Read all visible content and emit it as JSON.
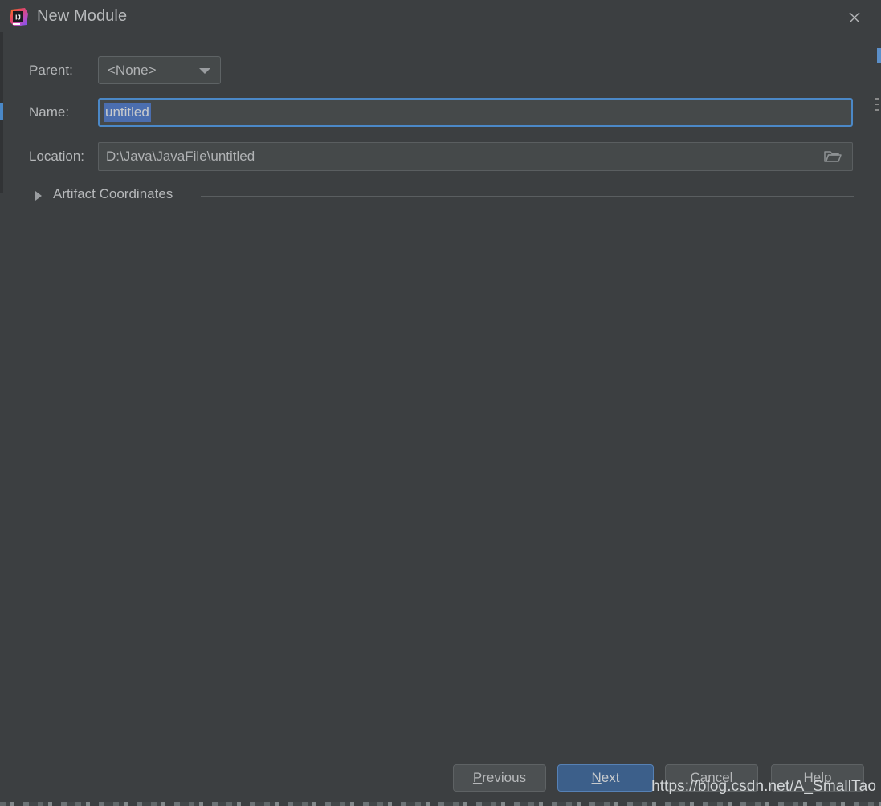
{
  "window": {
    "title": "New Module",
    "icon": "intellij-idea-logo",
    "close_icon": "close-icon"
  },
  "form": {
    "parent": {
      "label": "Parent:",
      "value": "<None>",
      "arrow_icon": "chevron-down-icon"
    },
    "name": {
      "label": "Name:",
      "value": "untitled",
      "selected": true
    },
    "location": {
      "label": "Location:",
      "value": "D:\\Java\\JavaFile\\untitled",
      "browse_icon": "folder-icon"
    }
  },
  "section": {
    "label": "Artifact Coordinates",
    "expanded": false,
    "arrow_icon": "triangle-right-icon"
  },
  "footer": {
    "previous": {
      "mnemonic": "P",
      "rest": "revious"
    },
    "next": {
      "mnemonic": "N",
      "rest": "ext"
    },
    "cancel": "Cancel",
    "help": "Help"
  },
  "watermark": "https://blog.csdn.net/A_SmallTao",
  "colors": {
    "dialog_background": "#3c3f41",
    "field_background": "#45494a",
    "focus_border": "#4b88c7",
    "selection": "#4b6eaf",
    "default_button": "#3c5f8a",
    "text": "#b6b8ba"
  }
}
